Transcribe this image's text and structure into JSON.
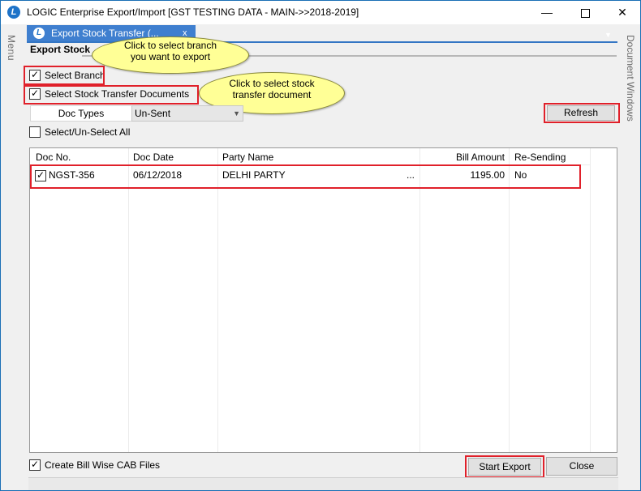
{
  "window": {
    "title": "LOGIC Enterprise Export/Import  [GST TESTING DATA - MAIN->>2018-2019]",
    "app_icon": "L",
    "minimize": "—",
    "close": "✕"
  },
  "side": {
    "menu_label": "Menu",
    "document_windows_label": "Document Windows"
  },
  "tab": {
    "label": "Export Stock Transfer (...",
    "close": "x",
    "dropdown": "▼"
  },
  "section": {
    "title": "Export Stock"
  },
  "options": {
    "select_branch": "Select Branch",
    "select_stock_transfer": "Select Stock Transfer Documents",
    "doc_types_label": "Doc Types",
    "doc_types_value": "Un-Sent",
    "select_all": "Select/Un-Select All",
    "create_cab": "Create Bill Wise CAB Files"
  },
  "callouts": {
    "branch_line1": "Click to select branch",
    "branch_line2": "you want to export",
    "stock_line1": "Click to select stock",
    "stock_line2": "transfer document"
  },
  "buttons": {
    "refresh": "Refresh",
    "start_export": "Start Export",
    "close": "Close"
  },
  "table": {
    "columns": [
      "Doc No.",
      "Doc Date",
      "Party Name",
      "Bill Amount",
      "Re-Sending"
    ],
    "rows": [
      {
        "doc_no": "NGST-356",
        "doc_date": "06/12/2018",
        "party_name": "DELHI PARTY",
        "ellipsis": "...",
        "bill_amount": "1195.00",
        "re_sending": "No"
      }
    ]
  },
  "colors": {
    "accent_blue": "#3f7fcf",
    "highlight_red": "#e0202a",
    "callout_yellow": "#ffff96"
  }
}
